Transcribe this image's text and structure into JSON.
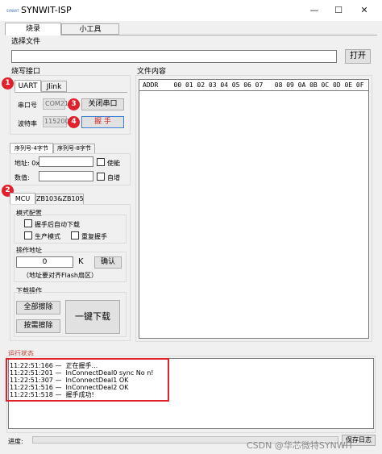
{
  "window": {
    "icon_text": "SYNWIT",
    "title": "SYNWIT-ISP",
    "minimize": "—",
    "maximize": "☐",
    "close": "✕"
  },
  "tabs": [
    {
      "label": "烧录"
    },
    {
      "label": "小工具"
    }
  ],
  "file_select": {
    "title": "选择文件",
    "path": "",
    "open_button": "打开"
  },
  "port": {
    "title": "烧写接口",
    "tabs": [
      "UART",
      "Jlink"
    ],
    "port_label": "串口号",
    "port_value": "COM21",
    "close_port_button": "关闭串口",
    "baud_label": "波特率",
    "baud_value": "115200",
    "handshake_button": "握  手"
  },
  "serial": {
    "tabs": [
      "序列号-4字节",
      "序列号-8字节"
    ],
    "addr_label": "地址: 0x",
    "enable_label": "使能",
    "value_label": "数值:",
    "auto_inc_label": "自增"
  },
  "mcu": {
    "tabs": [
      "MCU",
      "ZB103&ZB105"
    ],
    "mode_title": "模式配置",
    "auto_download_label": "握手后自动下载",
    "production_label": "生产模式",
    "repeat_handshake_label": "重复握手",
    "addr_title": "操作地址",
    "addr_value": "0",
    "addr_unit": "K",
    "confirm_button": "确认",
    "addr_note": "（地址要对齐Flash扇区）",
    "download_title": "下载操作",
    "erase_all_button": "全部擦除",
    "erase_sector_button": "按需擦除",
    "download_button": "一键下载"
  },
  "file_content": {
    "title": "文件内容",
    "header": "ADDR    00 01 02 03 04 05 06 07   08 09 0A 0B 0C 0D 0E 0F"
  },
  "status": {
    "title": "运行状态",
    "lines": [
      "11:22:51:166 —  正在握手...",
      "11:22:51:201 —  InConnectDeal0 sync No n!",
      "11:22:51:307 —  InConnectDeal1 OK",
      "11:22:51:516 —  InConnectDeal2 OK",
      "11:22:51:518 —  握手成功!"
    ]
  },
  "progress": {
    "label": "进度:",
    "value": 0,
    "side_button": "保存日志"
  },
  "badges": [
    "1",
    "2",
    "3",
    "4"
  ],
  "watermark": "CSDN @华芯微特SYNWIT",
  "colors": {
    "accent_red": "#e0202a",
    "tab_border": "#adadad"
  }
}
